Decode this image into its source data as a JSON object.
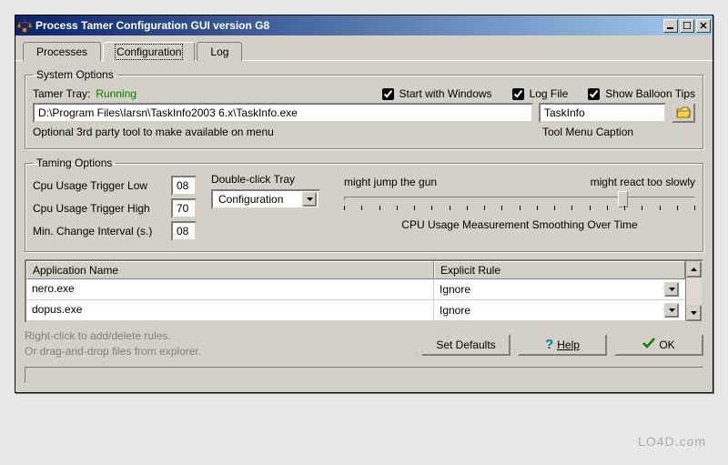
{
  "window": {
    "title": "Process Tamer Configuration GUI version G8"
  },
  "tabs": {
    "processes": "Processes",
    "configuration": "Configuration",
    "log": "Log",
    "active": "configuration"
  },
  "system_options": {
    "legend": "System Options",
    "tray_label": "Tamer Tray:",
    "tray_status": "Running",
    "start_with_windows": {
      "label": "Start with Windows",
      "checked": true
    },
    "log_file": {
      "label": "Log File",
      "checked": true
    },
    "show_balloon": {
      "label": "Show Balloon Tips",
      "checked": true
    },
    "tool_path": "D:\\Program Files\\Iarsn\\TaskInfo2003 6.x\\TaskInfo.exe",
    "tool_caption": "TaskInfo",
    "tool_path_hint": "Optional 3rd party tool to make available on menu",
    "tool_caption_hint": "Tool Menu Caption"
  },
  "taming_options": {
    "legend": "Taming Options",
    "cpu_low_label": "Cpu Usage Trigger Low",
    "cpu_low_value": "08",
    "cpu_high_label": "Cpu Usage Trigger High",
    "cpu_high_value": "70",
    "min_interval_label": "Min. Change Interval (s.)",
    "min_interval_value": "08",
    "dblclick_label": "Double-click Tray",
    "dblclick_value": "Configuration",
    "slider_left_hint": "might jump the gun",
    "slider_right_hint": "might react too slowly",
    "slider_caption": "CPU Usage Measurement Smoothing Over Time",
    "slider_position_pct": 78
  },
  "rules": {
    "col_app": "Application Name",
    "col_rule": "Explicit Rule",
    "rows": [
      {
        "app": "nero.exe",
        "rule": "Ignore"
      },
      {
        "app": "dopus.exe",
        "rule": "Ignore"
      }
    ]
  },
  "hints": {
    "line1": "Right-click to add/delete rules.",
    "line2": "Or drag-and-drop files from explorer."
  },
  "buttons": {
    "set_defaults": "Set Defaults",
    "help": "Help",
    "ok": "OK"
  },
  "watermark": "LO4D.com"
}
